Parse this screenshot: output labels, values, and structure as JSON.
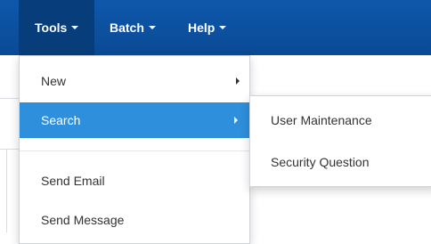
{
  "navbar": {
    "items": [
      {
        "label": "Tools"
      },
      {
        "label": "Batch"
      },
      {
        "label": "Help"
      }
    ]
  },
  "tools_menu": {
    "items": [
      {
        "label": "New"
      },
      {
        "label": "Search"
      },
      {
        "label": "Send Email"
      },
      {
        "label": "Send Message"
      }
    ]
  },
  "search_submenu": {
    "items": [
      {
        "label": "User Maintenance"
      },
      {
        "label": "Security Question"
      }
    ]
  },
  "colors": {
    "navbar_bg": "#0b4f9e",
    "active_nav_bg": "#083d7c",
    "highlight": "#2e8fdc"
  }
}
